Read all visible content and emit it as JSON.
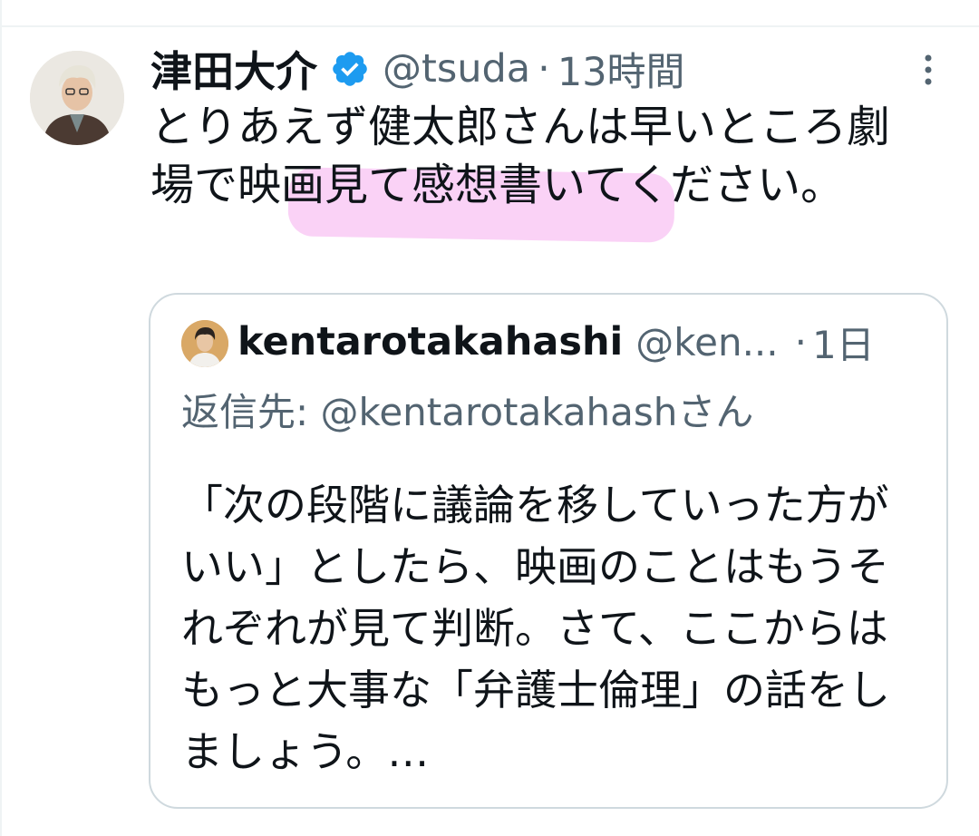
{
  "tweet": {
    "display_name": "津田大介",
    "verified_icon": "verified-badge-icon",
    "handle": "@tsuda",
    "dot": "·",
    "time": "13時間",
    "text_before": "とりあえず健太郎さんは早いところ劇場で",
    "text_highlight": "映画見て感想書い",
    "text_after": "てください。",
    "highlight_color": "#f9cdf5",
    "more_icon": "more-vertical-icon"
  },
  "quote": {
    "display_name": "kentarotakahashi",
    "handle": "@ken...",
    "dot": "·",
    "time": "1日",
    "reply_to": "返信先: @kentarotakahashさん",
    "text": "「次の段階に議論を移していった方がいい」としたら、映画のことはもうそれぞれが見て判断。さて、ここからはもっと大事な「弁護士倫理」の話をしましょう。…"
  },
  "colors": {
    "accent": "#1d9bf0",
    "secondary_text": "#536471",
    "border": "#cfd9de"
  }
}
